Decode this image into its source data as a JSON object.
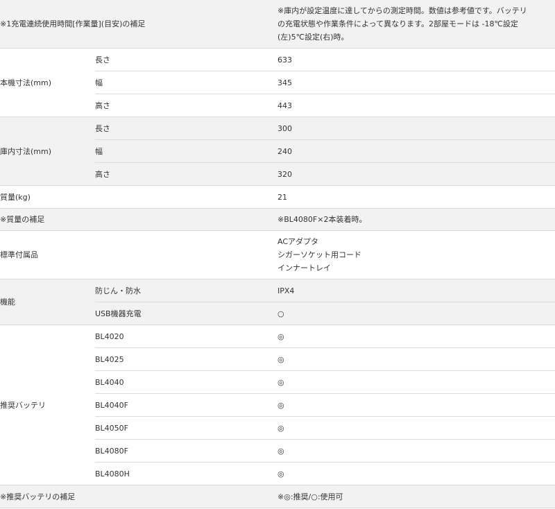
{
  "rows": {
    "note_operating_time": {
      "label": "※1充電連続使用時間[作業量](目安)の補足",
      "lines": [
        "※庫内が設定温度に達してからの測定時間。数値は参考値です。バッテリ",
        "の充電状態や作業条件によって異なります。2部屋モードは -18℃設定",
        "(左)5℃設定(右)時。"
      ]
    },
    "body_dimensions": {
      "label": "本機寸法(mm)",
      "items": [
        {
          "name": "長さ",
          "value": "633"
        },
        {
          "name": "幅",
          "value": "345"
        },
        {
          "name": "高さ",
          "value": "443"
        }
      ]
    },
    "interior_dimensions": {
      "label": "庫内寸法(mm)",
      "items": [
        {
          "name": "長さ",
          "value": "300"
        },
        {
          "name": "幅",
          "value": "240"
        },
        {
          "name": "高さ",
          "value": "320"
        }
      ]
    },
    "weight": {
      "label": "質量(kg)",
      "value": "21"
    },
    "weight_note": {
      "label": "※質量の補足",
      "value": "※BL4080F×2本装着時。"
    },
    "accessories": {
      "label": "標準付属品",
      "lines": [
        "ACアダプタ",
        "シガーソケット用コード",
        "インナートレイ"
      ]
    },
    "functions": {
      "label": "機能",
      "items": [
        {
          "name": "防じん・防水",
          "value": "IPX4"
        },
        {
          "name": "USB機器充電",
          "value": "○"
        }
      ]
    },
    "batteries": {
      "label": "推奨バッテリ",
      "items": [
        {
          "name": "BL4020",
          "value": "◎"
        },
        {
          "name": "BL4025",
          "value": "◎"
        },
        {
          "name": "BL4040",
          "value": "◎"
        },
        {
          "name": "BL4040F",
          "value": "◎"
        },
        {
          "name": "BL4050F",
          "value": "◎"
        },
        {
          "name": "BL4080F",
          "value": "◎"
        },
        {
          "name": "BL4080H",
          "value": "◎"
        }
      ]
    },
    "battery_note": {
      "label": "※推奨バッテリの補足",
      "value": "※◎:推奨/○:使用可"
    }
  }
}
